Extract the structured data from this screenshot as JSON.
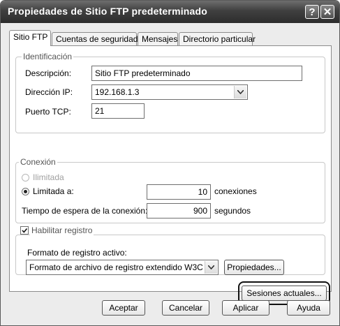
{
  "window": {
    "title": "Propiedades de Sitio FTP predeterminado",
    "help_glyph": "?",
    "close_glyph": "✕"
  },
  "tabs": [
    {
      "label": "Sitio FTP",
      "active": true
    },
    {
      "label": "Cuentas de seguridad",
      "active": false
    },
    {
      "label": "Mensajes",
      "active": false
    },
    {
      "label": "Directorio particular",
      "active": false
    }
  ],
  "identificacion": {
    "legend": "Identificación",
    "descripcion_label": "Descripción:",
    "descripcion_value": "Sitio FTP predeterminado",
    "ip_label": "Dirección IP:",
    "ip_value": "192.168.1.3",
    "puerto_label": "Puerto TCP:",
    "puerto_value": "21"
  },
  "conexion": {
    "legend": "Conexión",
    "ilimitada_label": "Ilimitada",
    "limitada_label": "Limitada a:",
    "limitada_value": "10",
    "limitada_unit": "conexiones",
    "tiempo_label": "Tiempo de espera de la conexión:",
    "tiempo_value": "900",
    "tiempo_unit": "segundos"
  },
  "registro": {
    "habilitar_label": "Habilitar registro",
    "habilitar_checked": true,
    "formato_label": "Formato de registro activo:",
    "formato_value": "Formato de archivo de registro extendido W3C",
    "propiedades_label": "Propiedades..."
  },
  "sesiones_label": "Sesiones actuales...",
  "footer": {
    "aceptar": "Aceptar",
    "cancelar": "Cancelar",
    "aplicar": "Aplicar",
    "ayuda": "Ayuda"
  }
}
